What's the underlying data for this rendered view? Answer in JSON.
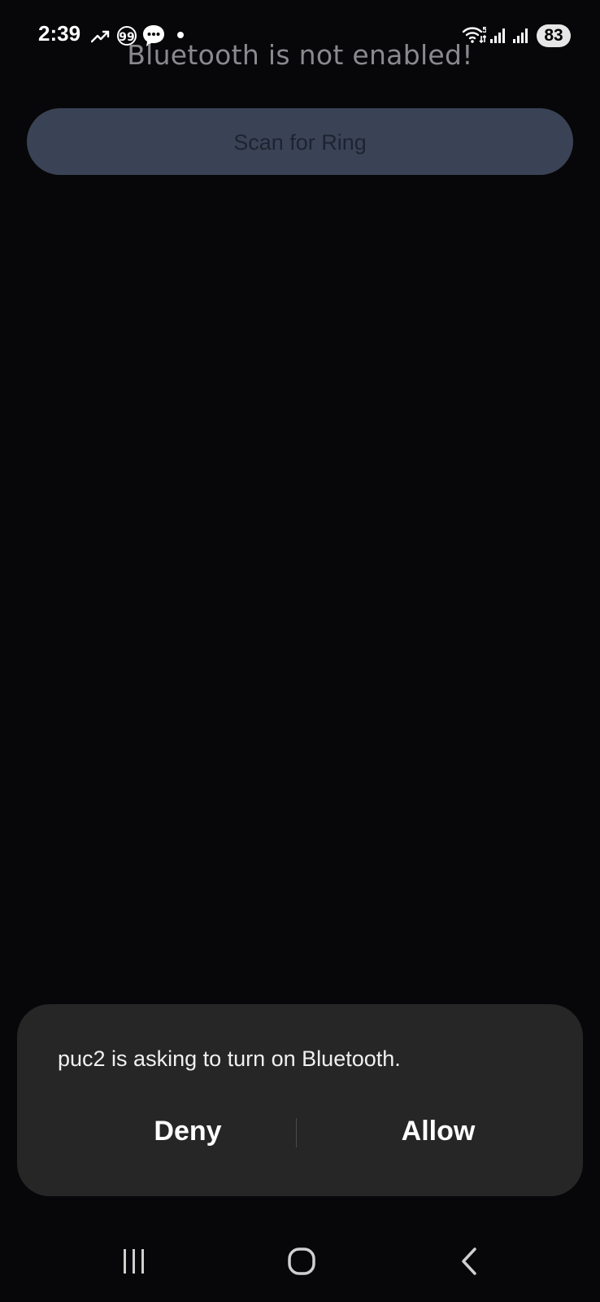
{
  "status_bar": {
    "time": "2:39",
    "battery": "83",
    "icons": [
      "trending-icon",
      "quote-icon",
      "chat-bubble-icon",
      "dot-icon",
      "wifi-icon",
      "signal-icon",
      "signal-icon"
    ]
  },
  "app": {
    "bluetooth_message": "Bluetooth is not enabled!",
    "scan_button_label": "Scan for Ring"
  },
  "dialog": {
    "message": "puc2 is asking to turn on Bluetooth.",
    "deny_label": "Deny",
    "allow_label": "Allow"
  },
  "nav_bar": {
    "items": [
      "recents-icon",
      "home-icon",
      "back-icon"
    ]
  },
  "colors": {
    "background": "#070709",
    "button": "#3a4355",
    "dialog": "#262626"
  }
}
